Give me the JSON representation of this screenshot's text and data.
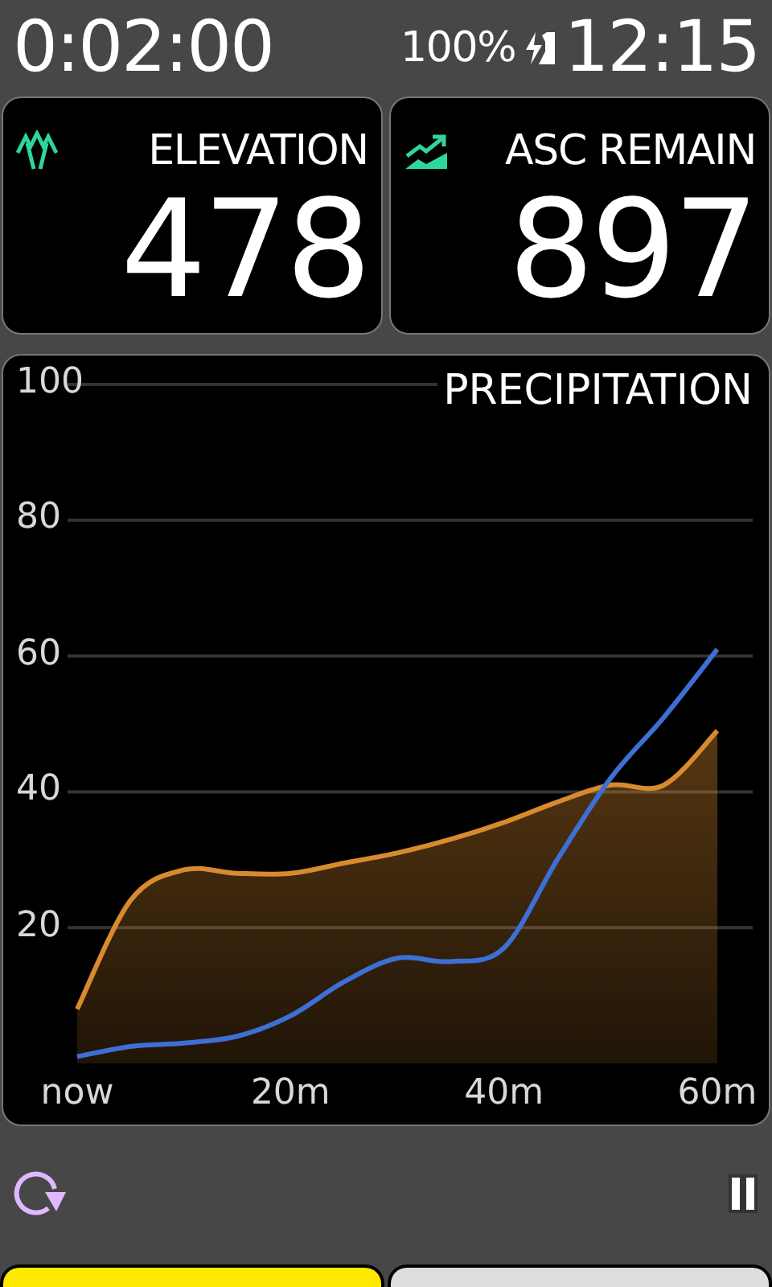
{
  "status_bar": {
    "timer": "0:02:00",
    "battery": "100%",
    "clock": "12:15"
  },
  "fields": [
    {
      "kind": "elevation",
      "label": "ELEVATION",
      "value": "478"
    },
    {
      "kind": "ascent",
      "label": "ASC REMAIN",
      "value": "897"
    }
  ],
  "precipitation": {
    "chart_data": {
      "type": "area",
      "title": "PRECIPITATION",
      "x": [
        0,
        5,
        10,
        15,
        20,
        25,
        30,
        35,
        40,
        45,
        50,
        55,
        60
      ],
      "series": [
        {
          "color": "#d88a2e",
          "values": [
            8,
            24,
            28.5,
            28,
            28,
            29.5,
            31,
            33,
            35.5,
            38.5,
            41,
            41,
            49
          ]
        },
        {
          "color": "#3d6fd6",
          "type": "line",
          "values": [
            1,
            2.5,
            3,
            4,
            7,
            12,
            15.5,
            15,
            17,
            30,
            42,
            51,
            61
          ]
        }
      ],
      "xlim": [
        0,
        60
      ],
      "ylim": [
        0,
        100
      ],
      "xticks": [
        {
          "value": 0,
          "label": "now"
        },
        {
          "value": 20,
          "label": "20m"
        },
        {
          "value": 40,
          "label": "40m"
        },
        {
          "value": 60,
          "label": "60m"
        }
      ],
      "yticks": [
        20,
        40,
        60,
        80,
        100
      ],
      "grid": true
    }
  },
  "pages": [
    {
      "selected": true
    },
    {
      "selected": false
    }
  ]
}
